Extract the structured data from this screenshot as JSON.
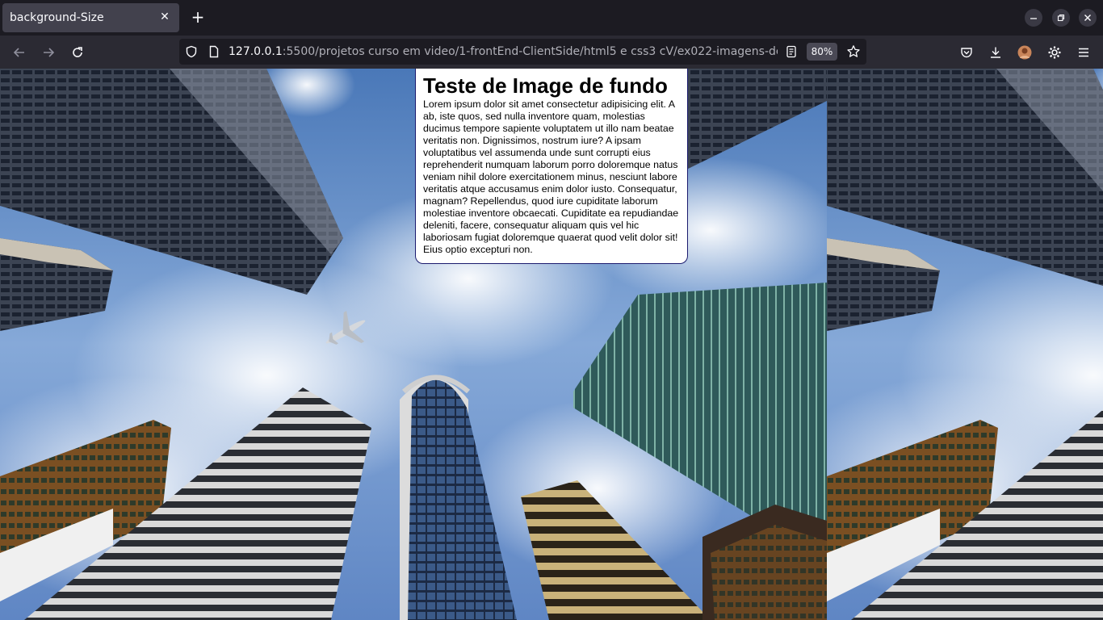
{
  "browser": {
    "tab_title": "background-Size",
    "url_host": "127.0.0.1",
    "url_rest": ":5500/projetos curso em video/1-frontEnd-ClientSide/html5 e css3 cV/ex022-imagens-de",
    "zoom": "80%"
  },
  "page": {
    "heading": "Teste de Image de fundo",
    "paragraph": "Lorem ipsum dolor sit amet consectetur adipisicing elit. A ab, iste quos, sed nulla inventore quam, molestias ducimus tempore sapiente voluptatem ut illo nam beatae veritatis non. Dignissimos, nostrum iure? A ipsam voluptatibus vel assumenda unde sunt corrupti eius reprehenderit numquam laborum porro doloremque natus veniam nihil dolore exercitationem minus, nesciunt labore veritatis atque accusamus enim dolor iusto. Consequatur, magnam? Repellendus, quod iure cupiditate laborum molestiae inventore obcaecati. Cupiditate ea repudiandae deleniti, facere, consequatur aliquam quis vel hic laboriosam fugiat doloremque quaerat quod velit dolor sit! Eius optio excepturi non."
  },
  "icons": {
    "back": "back-arrow-icon",
    "forward": "forward-arrow-icon",
    "reload": "reload-icon",
    "shield": "shield-icon",
    "page": "page-icon",
    "reader": "reader-view-icon",
    "bookmark": "star-icon",
    "pocket": "pocket-icon",
    "download": "download-icon",
    "account": "avatar-icon",
    "extensions": "gear-icon",
    "menu": "hamburger-menu-icon"
  },
  "colors": {
    "chrome_dark": "#1c1b22",
    "toolbar": "#2b2a33",
    "tab_active": "#42414d",
    "card_border": "#1a1a6e"
  }
}
